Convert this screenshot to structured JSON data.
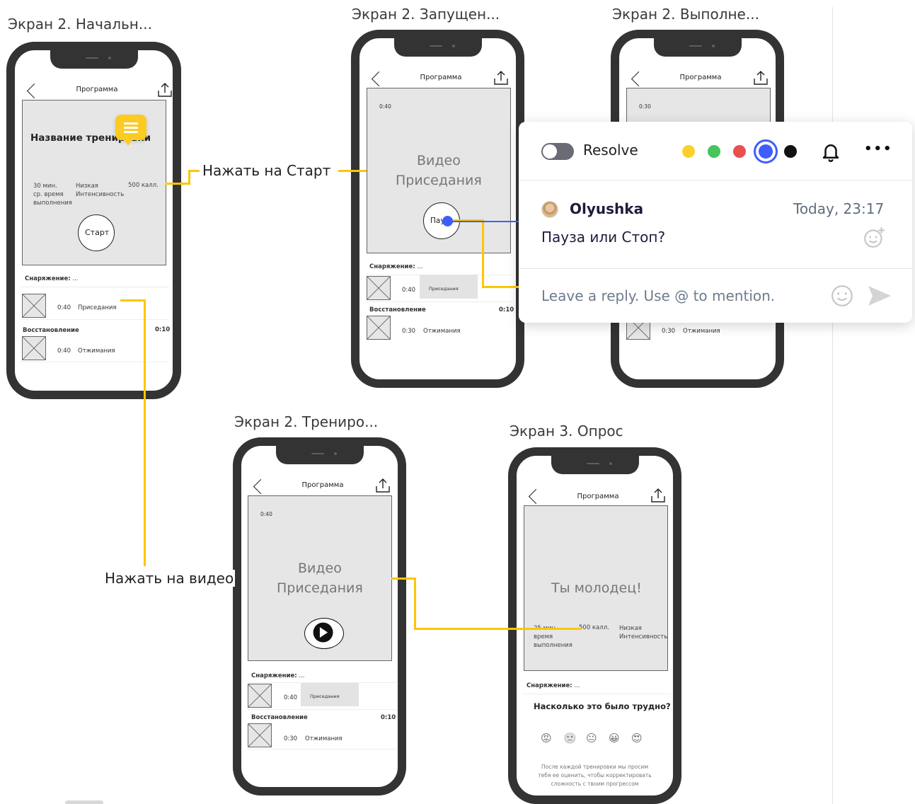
{
  "frames": {
    "f1": "Экран 2. Начальн...",
    "f2": "Экран 2. Запущен...",
    "f3": "Экран 2. Выполне...",
    "f4": "Экран 2. Трениро...",
    "f5": "Экран 3. Опрос"
  },
  "connectors": {
    "start": "Нажать на Старт",
    "video": "Нажать на видео"
  },
  "phone_common": {
    "nav_title": "Программа",
    "equipment_label": "Снаряжение:",
    "equipment_value": "...",
    "recovery_label": "Восстановление",
    "recovery_time": "0:10",
    "ex1_time": "0:40",
    "ex1_name": "Приседания",
    "ex2_time_a": "0:40",
    "ex2_time_b": "0:30",
    "ex2_name": "Отжимания"
  },
  "phone1": {
    "workout_name": "Название тренировки",
    "stat1_a": "30 мин.",
    "stat1_b": "ср. время",
    "stat1_c": "выполнения",
    "stat2_a": "Низкая",
    "stat2_b": "Интенсивность",
    "stat3": "500 калл.",
    "start_button": "Старт"
  },
  "phone2": {
    "timer": "0:40",
    "video_line1": "Видео",
    "video_line2": "Приседания",
    "pause_button": "Пауза"
  },
  "phone3": {
    "timer": "0:30"
  },
  "phone4": {
    "timer": "0:40",
    "video_line1": "Видео",
    "video_line2": "Приседания"
  },
  "phone5": {
    "congrats": "Ты молодец!",
    "stat1_a": "25 мин.",
    "stat1_b": "время",
    "stat1_c": "выполнения",
    "stat3": "500 калл.",
    "stat2_a": "Низкая",
    "stat2_b": "Интенсивность",
    "question": "Насколько это было трудно?",
    "emojis": [
      "😡",
      "🙁",
      "😐",
      "😀",
      "😍"
    ],
    "note1": "После каждой тренировки мы просим",
    "note2": "тебя ее оценить, чтобы корректировать",
    "note3": "сложность с твоим прогрессом"
  },
  "comment_panel": {
    "resolve_label": "Resolve",
    "colors": [
      "#fcd12a",
      "#46c45e",
      "#e84f4f",
      "#3d5efc",
      "#111111"
    ],
    "selected_color": "#3d5efc",
    "author": "Olyushka",
    "time": "Today, 23:17",
    "message": "Пауза или Стоп?",
    "reply_placeholder": "Leave a reply. Use @ to mention.",
    "more_label": "•••"
  }
}
